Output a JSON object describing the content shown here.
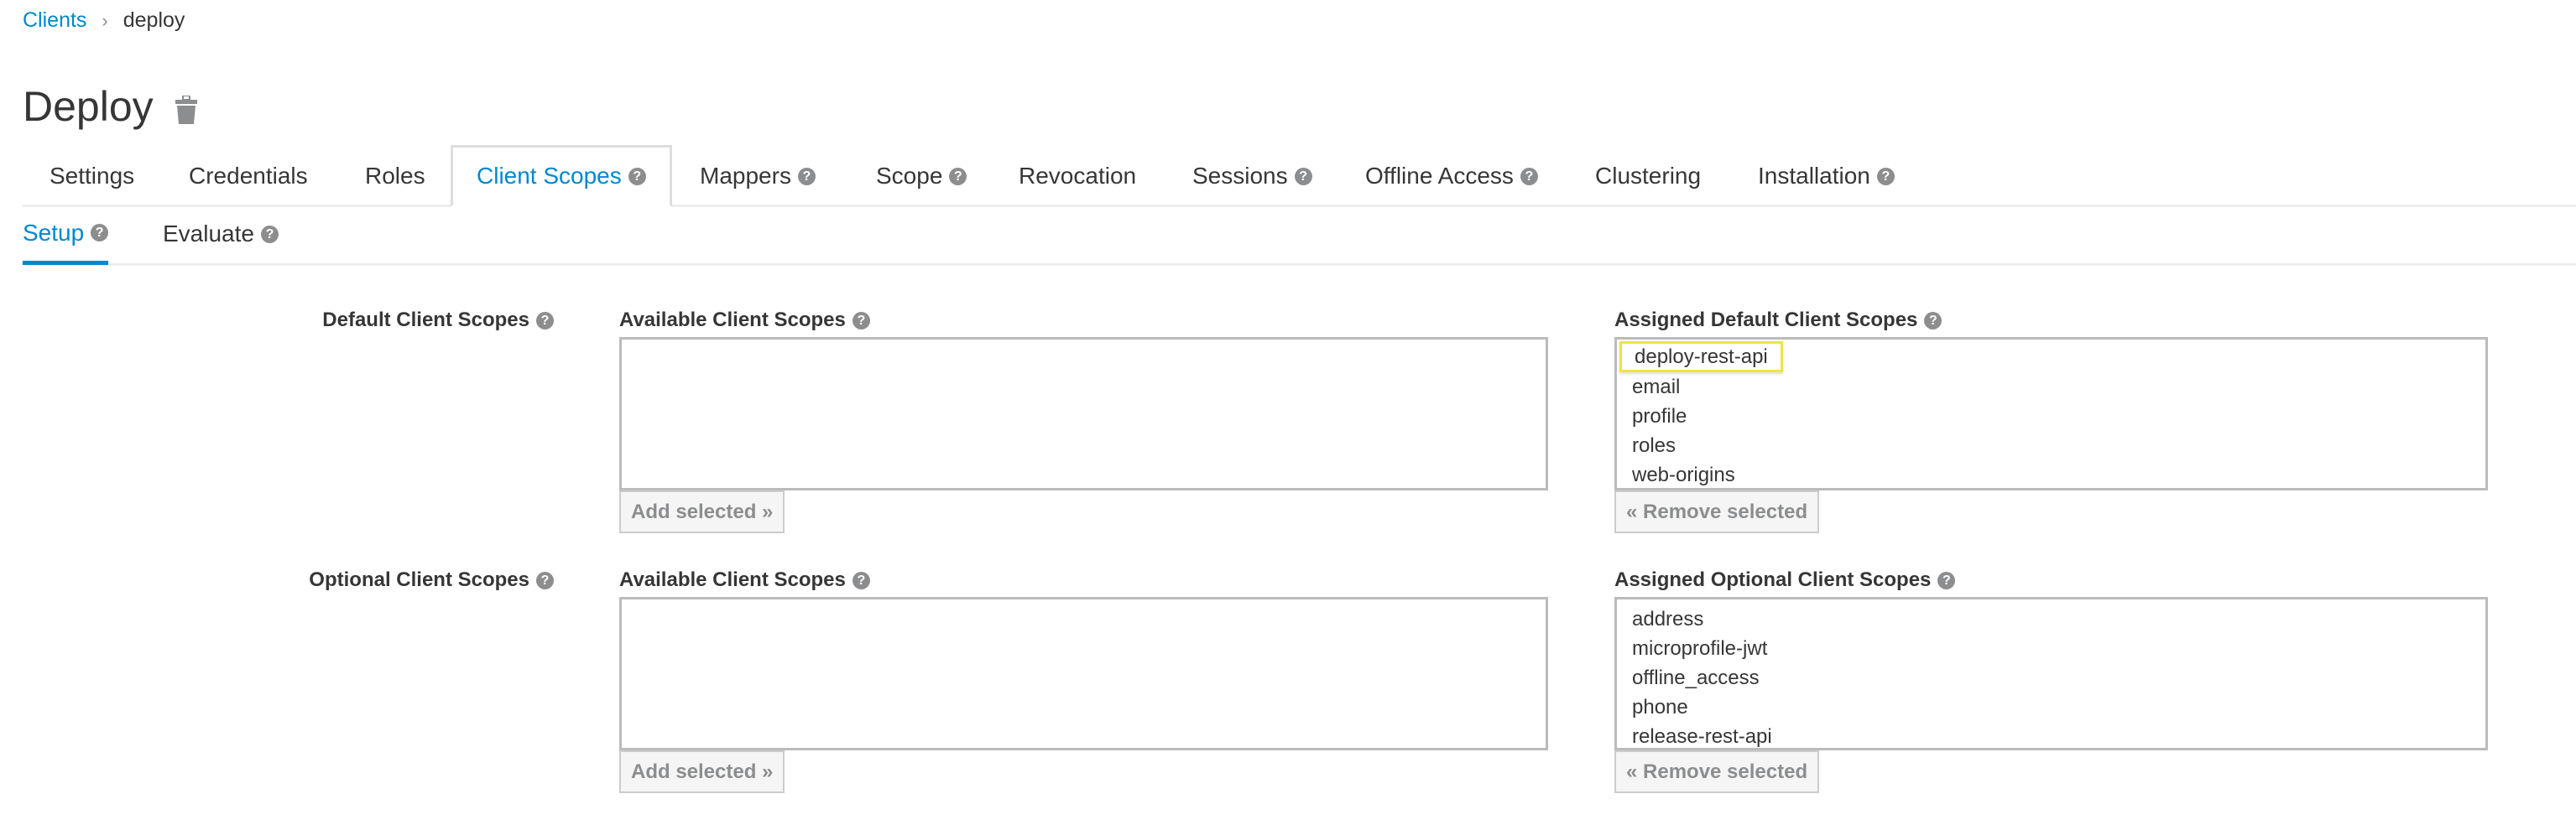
{
  "breadcrumb": {
    "parent": "Clients",
    "separator": "›",
    "current": "deploy"
  },
  "page": {
    "title": "Deploy"
  },
  "tabs": [
    {
      "label": "Settings",
      "help": false
    },
    {
      "label": "Credentials",
      "help": false
    },
    {
      "label": "Roles",
      "help": false
    },
    {
      "label": "Client Scopes",
      "help": true,
      "active": true
    },
    {
      "label": "Mappers",
      "help": true
    },
    {
      "label": "Scope",
      "help": true
    },
    {
      "label": "Revocation",
      "help": false
    },
    {
      "label": "Sessions",
      "help": true
    },
    {
      "label": "Offline Access",
      "help": true
    },
    {
      "label": "Clustering",
      "help": false
    },
    {
      "label": "Installation",
      "help": true
    }
  ],
  "subtabs": [
    {
      "label": "Setup",
      "active": true
    },
    {
      "label": "Evaluate"
    }
  ],
  "help_glyph": "?",
  "default_scopes": {
    "label": "Default Client Scopes",
    "available_label": "Available Client Scopes",
    "available": [],
    "add_button": "Add selected »",
    "assigned_label": "Assigned Default Client Scopes",
    "assigned": [
      "deploy-rest-api",
      "email",
      "profile",
      "roles",
      "web-origins"
    ],
    "remove_button": "« Remove selected"
  },
  "optional_scopes": {
    "label": "Optional Client Scopes",
    "available_label": "Available Client Scopes",
    "available": [],
    "add_button": "Add selected »",
    "assigned_label": "Assigned Optional Client Scopes",
    "assigned": [
      "address",
      "microprofile-jwt",
      "offline_access",
      "phone",
      "release-rest-api"
    ],
    "remove_button": "« Remove selected"
  },
  "colors": {
    "accent": "#0088ce",
    "text": "#363636",
    "focus_outline": "#f0e442",
    "help_icon": "#8b8d8f"
  }
}
